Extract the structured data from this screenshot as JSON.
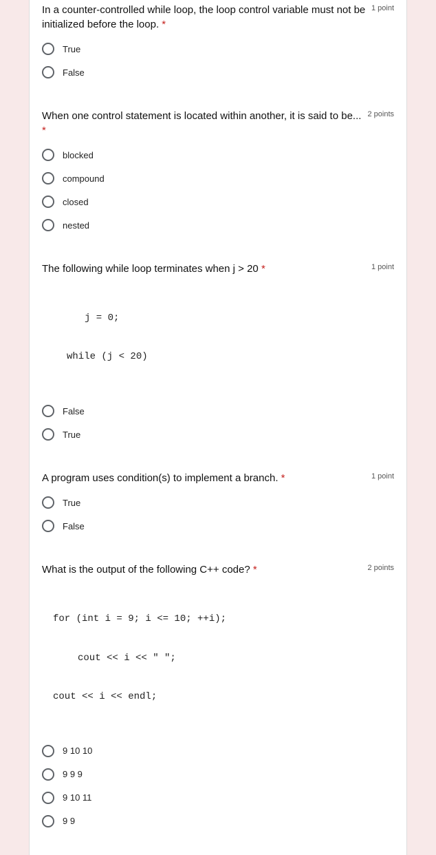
{
  "questions": [
    {
      "title": "In a counter-controlled while loop, the loop control variable must not be initialized before the loop.",
      "points": "1 point",
      "options": [
        "True",
        "False"
      ]
    },
    {
      "title": "When one control statement is located within another, it is said to be...",
      "points": "2 points",
      "options": [
        "blocked",
        "compound",
        "closed",
        "nested"
      ]
    },
    {
      "title": "The following while loop terminates when j > 20",
      "points": "1 point",
      "code": [
        "j = 0;",
        "while (j < 20)"
      ],
      "options": [
        "False",
        "True"
      ]
    },
    {
      "title": "A program uses condition(s) to implement a branch.",
      "points": "1 point",
      "options": [
        "True",
        "False"
      ]
    },
    {
      "title": "What is the output of the following C++ code?",
      "points": "2 points",
      "code2": [
        "for (int i = 9; i <= 10; ++i);",
        "cout << i << \" \";",
        "cout << i << endl;"
      ],
      "options": [
        "9 10 10",
        "9 9 9",
        "9 10 11",
        "9 9"
      ]
    }
  ],
  "required_mark": "*"
}
